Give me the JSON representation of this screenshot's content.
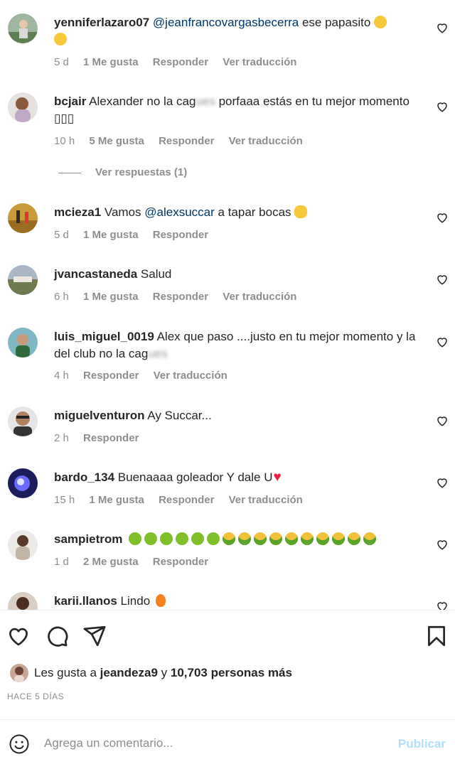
{
  "comments": [
    {
      "user": "yenniferlazaro07",
      "mention": "@jeanfrancovargasbecerra",
      "text": " ese papasito",
      "emoji": "😅😅",
      "time": "5 d",
      "likes": "1 Me gusta",
      "reply": "Responder",
      "translate": "Ver traducción"
    },
    {
      "user": "bcjair",
      "text_pre": " Alexander no la cag",
      "text_blur": "ues",
      "text_post": " porfaaa estás en tu mejor momento ▯▯▯",
      "time": "10 h",
      "likes": "5 Me gusta",
      "reply": "Responder",
      "translate": "Ver traducción"
    },
    {
      "user": "mcieza1",
      "text_pre": " Vamos ",
      "mention": "@alexsuccar",
      "text_post": " a tapar bocas",
      "time": "5 d",
      "likes": "1 Me gusta",
      "reply": "Responder"
    },
    {
      "user": "jvancastaneda",
      "text": " Salud",
      "time": "6 h",
      "likes": "1 Me gusta",
      "reply": "Responder",
      "translate": "Ver traducción"
    },
    {
      "user": "luis_miguel_0019",
      "text_pre": " Alex que paso ....justo en tu mejor momento y la del club no la cag",
      "text_blur": "ues",
      "time": "4 h",
      "reply": "Responder",
      "translate": "Ver traducción"
    },
    {
      "user": "miguelventuron",
      "text": " Ay Succar...",
      "time": "2 h",
      "reply": "Responder"
    },
    {
      "user": "bardo_134",
      "text": " Buenaaaa goleador Y dale U",
      "time": "15 h",
      "likes": "1 Me gusta",
      "reply": "Responder",
      "translate": "Ver traducción"
    },
    {
      "user": "sampietrom",
      "time": "1 d",
      "likes": "2 Me gusta",
      "reply": "Responder"
    },
    {
      "user": "karii.llanos",
      "text": " Lindo"
    }
  ],
  "view_replies": "Ver respuestas (1)",
  "likes_line": {
    "prefix": "Les gusta a ",
    "user": "jeandeza9",
    "middle": " y ",
    "count": "10,703 personas más"
  },
  "post_date": "HACE 5 DÍAS",
  "add_comment": {
    "placeholder": "Agrega un comentario...",
    "post_label": "Publicar"
  },
  "icons": {
    "like": "heart-icon",
    "comment": "comment-icon",
    "share": "send-icon",
    "save": "bookmark-icon",
    "emoji": "smile-icon"
  },
  "colors": {
    "text": "#262626",
    "muted": "#8e8e8e",
    "mention": "#00376b",
    "post_disabled": "#b2dffc",
    "heart_red": "#ed1c43"
  }
}
